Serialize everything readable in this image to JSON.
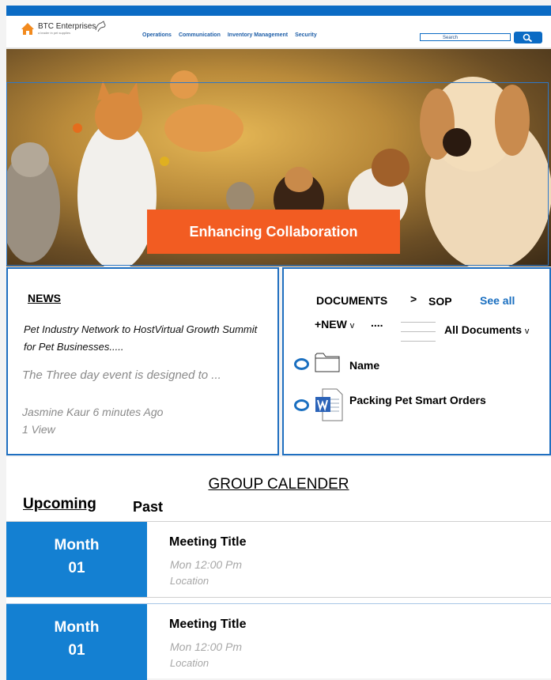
{
  "header": {
    "brand": "BTC Enterprises",
    "tagline": "a leader in pet supplies",
    "nav": [
      "Operations",
      "Communication",
      "Inventory Management",
      "Security"
    ],
    "search_placeholder": "Search"
  },
  "hero": {
    "banner": "Enhancing Collaboration"
  },
  "news": {
    "title": "NEWS",
    "headline": "Pet Industry Network to  HostVirtual Growth Summit for Pet Businesses.....",
    "summary": "The Three day event is designed to ...",
    "author_time": "Jasmine Kaur 6 minutes Ago",
    "views": "1 View"
  },
  "documents": {
    "title": "DOCUMENTS",
    "separator": ">",
    "crumb": "SOP",
    "see_all": "See all",
    "new_label": "+NEW",
    "new_caret": "v",
    "more": "....",
    "view_label": "All Documents",
    "view_caret": "v",
    "rows": [
      {
        "name": "Name",
        "icon": "folder-icon"
      },
      {
        "name": "Packing Pet Smart Orders",
        "icon": "word-doc-icon"
      }
    ]
  },
  "calendar": {
    "title": "GROUP CALENDER",
    "tabs": [
      "Upcoming",
      "Past"
    ],
    "events": [
      {
        "month": "Month",
        "day": "01",
        "title": "Meeting Title",
        "time": "Mon 12:00 Pm",
        "location": "Location"
      },
      {
        "month": "Month",
        "day": "01",
        "title": "Meeting Title",
        "time": "Mon 12:00 Pm",
        "location": "Location"
      }
    ]
  },
  "colors": {
    "brand_blue": "#0b6bc4",
    "banner_orange": "#f25c22",
    "event_blue": "#1480d2"
  }
}
